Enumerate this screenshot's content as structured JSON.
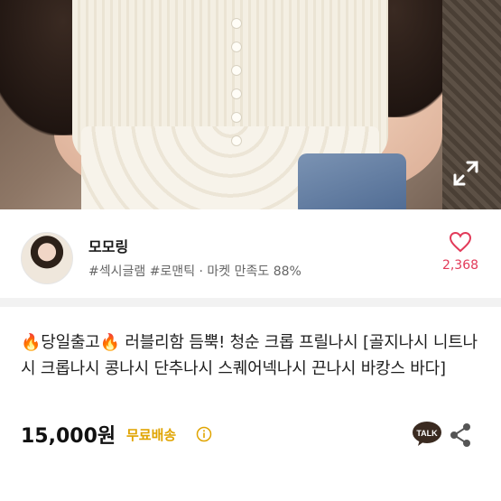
{
  "seller": {
    "name": "모모링",
    "tags": "#섹시글램 #로맨틱 · 마켓 만족도 88%",
    "likes": "2,368"
  },
  "product": {
    "title": "🔥당일출고🔥 러블리함 듬뿍! 청순 크롭 프릴나시 [골지나시 니트나시 크롭나시 콩나시 단추나시 스퀘어넥나시 끈나시 바캉스 바다]",
    "price": "15,000원",
    "shipping": "무료배송"
  },
  "colors": {
    "like": "#e23a59",
    "shipping": "#e0a400",
    "talk_badge": "#3a2a20"
  },
  "icons": {
    "expand": "expand-icon",
    "heart": "heart-icon",
    "info": "info-icon",
    "talk": "kakaotalk-icon",
    "share": "share-icon"
  },
  "labels": {
    "talk": "TALK"
  }
}
